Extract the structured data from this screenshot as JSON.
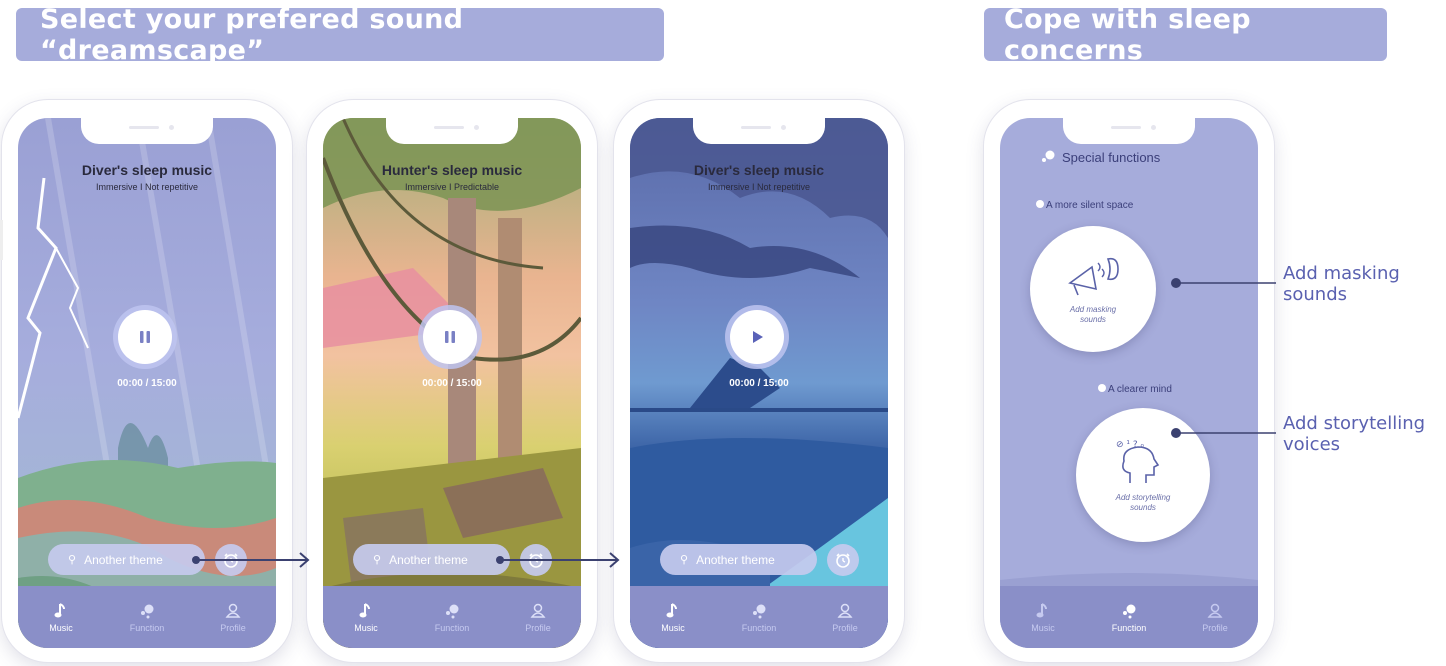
{
  "banners": {
    "left": "Select your prefered sound “dreamscape”",
    "right": "Cope with sleep concerns"
  },
  "phones": [
    {
      "title": "Diver's sleep music",
      "subtitle": "Immersive I Not repetitive",
      "time": "00:00 / 15:00",
      "control": "pause-icon",
      "theme_label": "Another theme"
    },
    {
      "title": "Hunter's sleep music",
      "subtitle": "Immersive I Predictable",
      "time": "00:00 / 15:00",
      "control": "pause-icon",
      "theme_label": "Another theme"
    },
    {
      "title": "Diver's sleep music",
      "subtitle": "Immersive I Not repetitive",
      "time": "00:00 / 15:00",
      "control": "play-icon",
      "theme_label": "Another theme"
    }
  ],
  "nav": {
    "music": "Music",
    "function": "Function",
    "profile": "Profile"
  },
  "functions": {
    "title": "Special functions",
    "section1": "A more silent space",
    "card1": "Add masking sounds",
    "section2": "A clearer mind",
    "card2": "Add storytelling sounds"
  },
  "callouts": {
    "masking": "Add masking sounds",
    "storytelling": "Add storytelling voices"
  },
  "colors": {
    "banner": "#a6acdb",
    "navbar": "#8a8fc8",
    "accent": "#3b4170",
    "callout_text": "#5a61b0"
  }
}
